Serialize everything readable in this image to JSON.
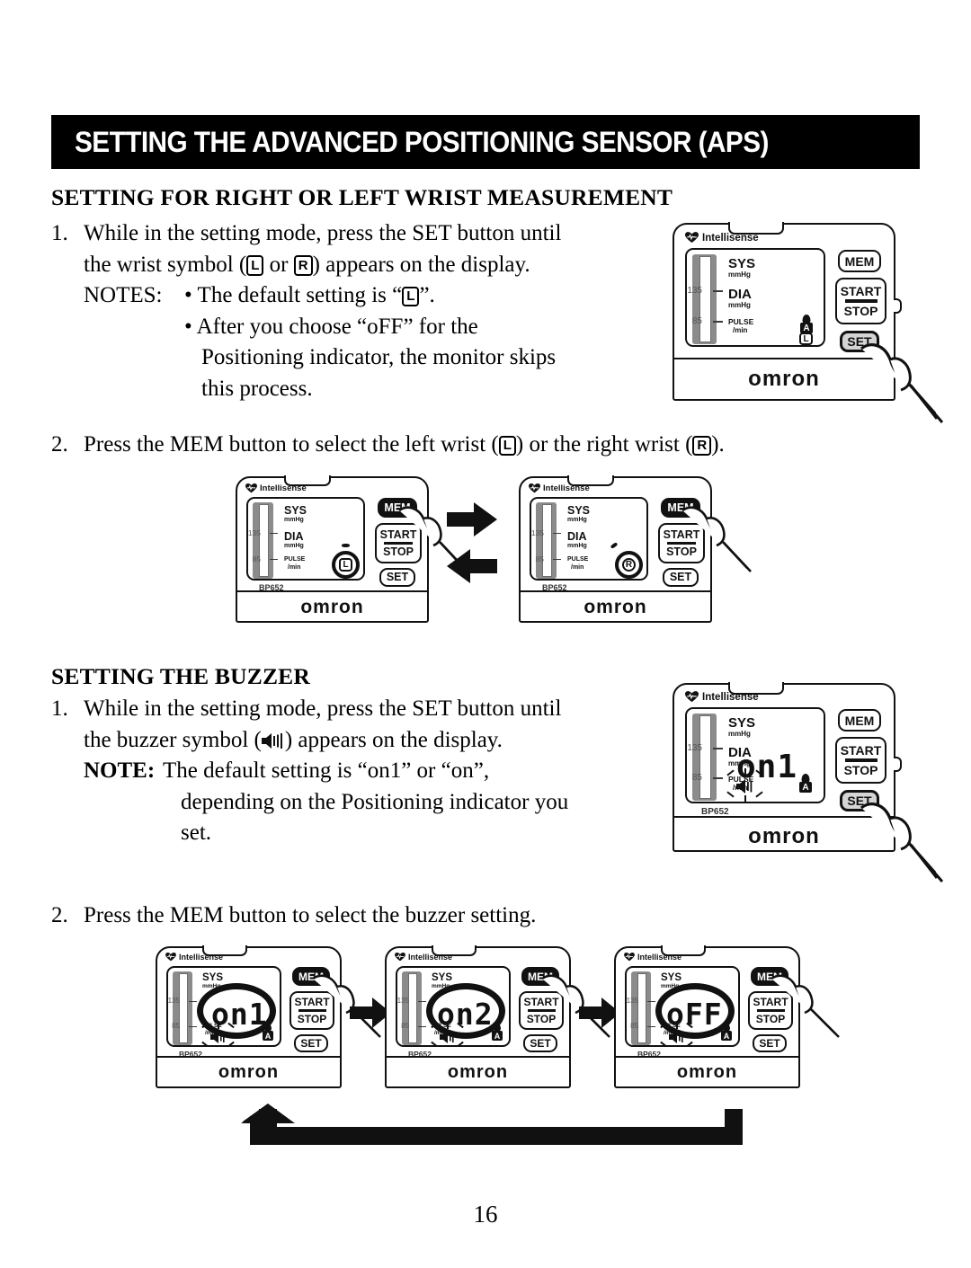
{
  "banner": {
    "title": "SETTING THE ADVANCED POSITIONING SENSOR (APS)"
  },
  "section1": {
    "heading": "SETTING FOR RIGHT OR LEFT WRIST MEASUREMENT",
    "step1_num": "1.",
    "step1_line1": "While in the setting mode, press the SET button until",
    "step1_line2_a": "the wrist symbol (",
    "step1_line2_glyph1": "L",
    "step1_line2_b": " or ",
    "step1_line2_glyph2": "R",
    "step1_line2_c": ") appears on the display.",
    "notes_label": "NOTES:",
    "note1_a": "• The default setting is “",
    "note1_glyph": "L",
    "note1_b": "”.",
    "note2_line1": "• After you choose “oFF” for the",
    "note2_line2": "Positioning indicator, the monitor skips",
    "note2_line3": "this process.",
    "step2_num": "2.",
    "step2_a": "Press the MEM button to select the left wrist (",
    "step2_glyph1": "L",
    "step2_b": ") or the right wrist (",
    "step2_glyph2": "R",
    "step2_c": ")."
  },
  "section2": {
    "heading": "SETTING THE BUZZER",
    "step1_num": "1.",
    "step1_line1": "While in the setting mode, press the SET button until",
    "step1_line2_a": "the buzzer symbol (",
    "step1_line2_b": ") appears on the display.",
    "note_label": "NOTE:",
    "note_line1": "The default setting is “on1” or “on”,",
    "note_line2": "depending on the Positioning indicator you",
    "note_line3": "set.",
    "step2_num": "2.",
    "step2_text": "Press the MEM button to select the buzzer setting."
  },
  "device": {
    "brand": "Intellisense",
    "logo": "omron",
    "model": "BP652",
    "sys_label": "SYS",
    "sys_unit": "mmHg",
    "dia_label": "DIA",
    "dia_unit": "mmHg",
    "pulse_label": "PULSE",
    "pulse_unit": "/min",
    "scale_high": "135",
    "scale_low": "85",
    "btn_mem": "MEM",
    "btn_start": "START",
    "btn_stop": "STOP",
    "btn_set": "SET",
    "a_indicator": "A"
  },
  "devices": {
    "d1_wrist": "L",
    "d2_wrist": "L",
    "d3_wrist": "R",
    "d4_readout": "on1",
    "d5_readout": "on1",
    "d6_readout": "on2",
    "d7_readout": "oFF"
  },
  "footer": {
    "page": "16"
  }
}
